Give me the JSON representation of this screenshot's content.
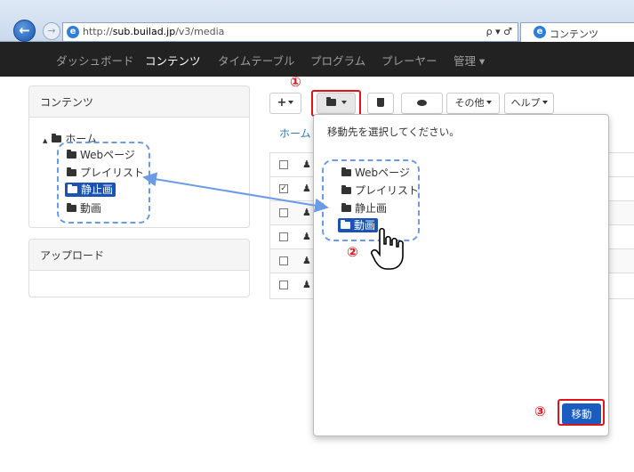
{
  "browser": {
    "url_prefix": "http://",
    "url_host": "sub.builad.jp",
    "url_path": "/v3/media",
    "addr_tools": "ρ ▾ ♂",
    "tab_title": "コンテンツ"
  },
  "navbar": {
    "items": [
      "ダッシュボード",
      "コンテンツ",
      "タイムテーブル",
      "プログラム",
      "プレーヤー",
      "管理 ▾"
    ]
  },
  "sidebar": {
    "contents_title": "コンテンツ",
    "tree_expander": "▲",
    "tree_root": "ホーム",
    "tree_items": [
      "Webページ",
      "プレイリスト",
      "静止画",
      "動画"
    ],
    "upload_title": "アップロード"
  },
  "toolbar": {
    "add_label": "+",
    "delete_icon": "trash-icon",
    "view_icon": "eye-icon",
    "other_label": "その他",
    "help_label": "ヘルプ"
  },
  "breadcrumb": "ホーム",
  "table": {
    "rows": 6,
    "checked_row": 1
  },
  "dialog": {
    "title": "移動先を選択してください。",
    "tree_items": [
      "Webページ",
      "プレイリスト",
      "静止画",
      "動画"
    ],
    "move_button": "移動"
  },
  "annotations": {
    "step1": "①",
    "step2": "②",
    "step3": "③"
  },
  "colors": {
    "accent": "#1a52b5",
    "highlight": "#e0141b",
    "dashed": "#6c9be6"
  }
}
